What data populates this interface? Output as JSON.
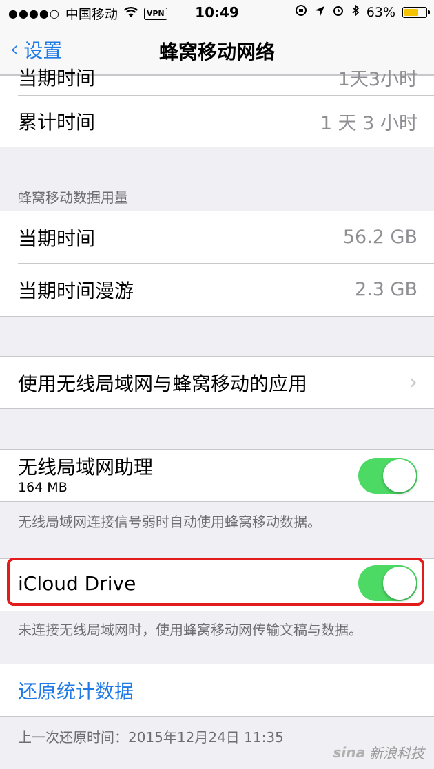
{
  "status_bar": {
    "signal_dots": "●●●●○",
    "carrier": "中国移动",
    "vpn": "VPN",
    "time": "10:49",
    "battery": "63%"
  },
  "nav": {
    "back_label": "设置",
    "title": "蜂窝移动网络"
  },
  "call_time": {
    "partial_label": "当期时间",
    "partial_value": "1天3小时",
    "total_label": "累计时间",
    "total_value": "1 天 3 小时"
  },
  "data_usage": {
    "header": "蜂窝移动数据用量",
    "current_label": "当期时间",
    "current_value": "56.2 GB",
    "roaming_label": "当期时间漫游",
    "roaming_value": "2.3 GB"
  },
  "apps_row": {
    "label": "使用无线局域网与蜂窝移动的应用"
  },
  "wifi_assist": {
    "label": "无线局域网助理",
    "sublabel": "164 MB",
    "enabled": true,
    "footer": "无线局域网连接信号弱时自动使用蜂窝移动数据。"
  },
  "icloud": {
    "label": "iCloud Drive",
    "enabled": true,
    "footer": "未连接无线局域网时，使用蜂窝移动网传输文稿与数据。"
  },
  "reset": {
    "label": "还原统计数据",
    "footer": "上一次还原时间：2015年12月24日 11:35"
  },
  "watermark": {
    "logo": "sina",
    "text": "新浪科技"
  },
  "colors": {
    "accent": "#1f7ae6",
    "toggle_on": "#4cd964",
    "highlight": "#e21b1b",
    "battery": "#f5c400"
  }
}
